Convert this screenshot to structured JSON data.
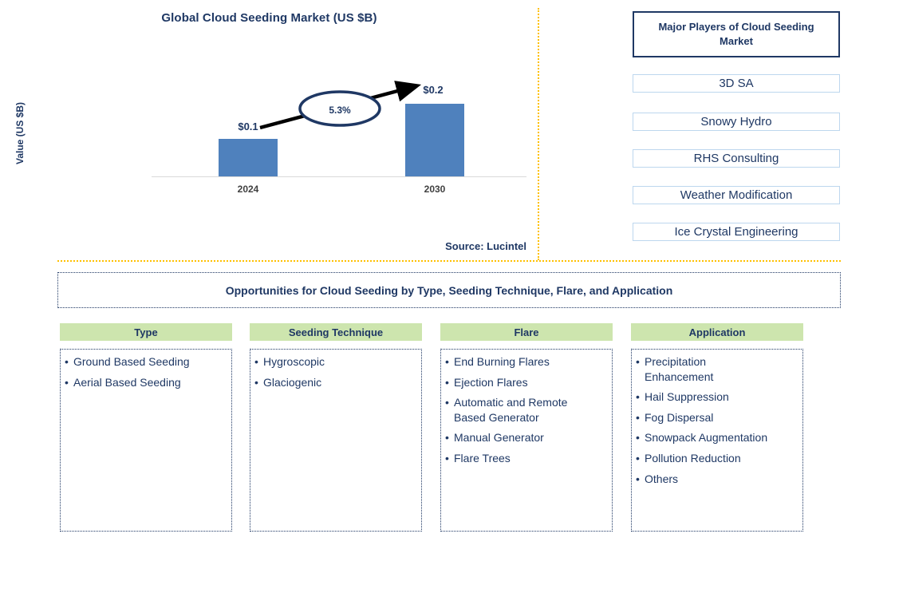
{
  "chart_panel": {
    "title": "Global Cloud Seeding Market (US $B)",
    "y_axis_label": "Value (US $B)",
    "cagr_label": "5.3%",
    "source": "Source: Lucintel"
  },
  "chart_data": {
    "type": "bar",
    "title": "Global Cloud Seeding Market (US $B)",
    "xlabel": "",
    "ylabel": "Value (US $B)",
    "categories": [
      "2024",
      "2030"
    ],
    "values": [
      0.1,
      0.2
    ],
    "value_labels": [
      "$0.1",
      "$0.2"
    ],
    "ylim": [
      0,
      0.22
    ],
    "grid": false,
    "legend": "none",
    "annotations": [
      {
        "text": "5.3%",
        "type": "cagr-ellipse",
        "from": "2024",
        "to": "2030"
      }
    ],
    "bar_color": "#4F81BD",
    "source": "Source: Lucintel"
  },
  "players_panel": {
    "header": "Major Players of Cloud Seeding Market",
    "items": [
      "3D SA",
      "Snowy Hydro",
      "RHS Consulting",
      "Weather Modification",
      "Ice Crystal Engineering"
    ]
  },
  "opportunities": {
    "banner": "Opportunities for Cloud Seeding by Type, Seeding Technique, Flare, and Application",
    "columns": [
      {
        "header": "Type",
        "items": [
          "Ground Based Seeding",
          "Aerial Based Seeding"
        ]
      },
      {
        "header": "Seeding Technique",
        "items": [
          "Hygroscopic",
          "Glaciogenic"
        ]
      },
      {
        "header": "Flare",
        "items": [
          "End Burning Flares",
          "Ejection Flares",
          "Automatic and Remote\nBased Generator",
          "Manual Generator",
          "Flare Trees"
        ]
      },
      {
        "header": "Application",
        "items": [
          "Precipitation\nEnhancement",
          "Hail Suppression",
          "Fog Dispersal",
          "Snowpack Augmentation",
          "Pollution Reduction",
          "Others"
        ]
      }
    ]
  },
  "colors": {
    "navy": "#1F3864",
    "bar_blue": "#4F81BD",
    "header_green": "#CDE5AE",
    "divider_orange": "#FFC000",
    "player_border": "#BDD7EE"
  }
}
